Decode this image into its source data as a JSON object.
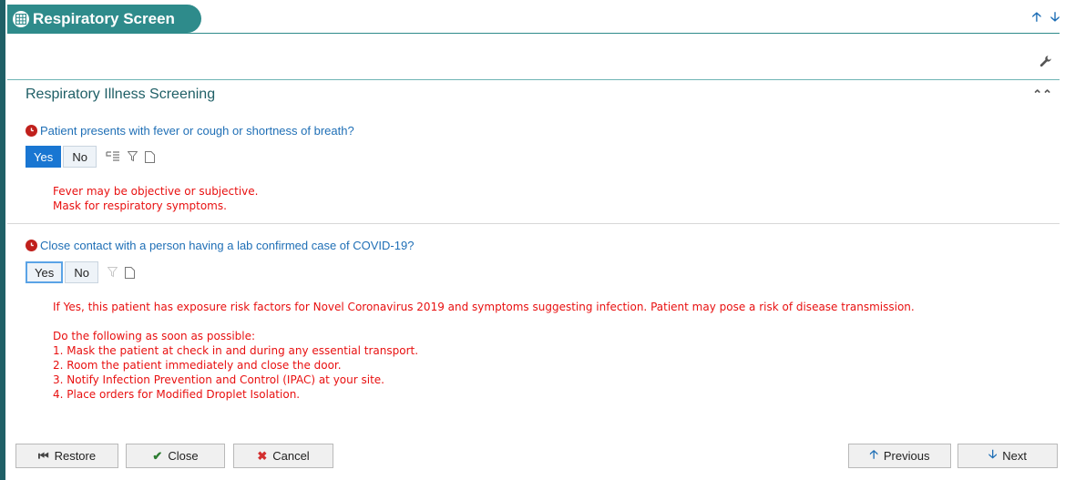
{
  "window": {
    "title": "Respiratory Screen",
    "title_icon": "grid-table-icon",
    "nav_up_icon": "arrow-up-icon",
    "nav_down_icon": "arrow-down-icon",
    "settings_icon": "wrench-icon"
  },
  "section": {
    "title": "Respiratory Illness Screening",
    "collapse_icon": "double-chevron-up-icon"
  },
  "questions": [
    {
      "text": "Patient presents with fever or cough or shortness of breath?",
      "required_icon": "required-clock-icon",
      "options": [
        "Yes",
        "No"
      ],
      "selected": "Yes",
      "notes": [
        "Fever may be objective or subjective.",
        "Mask for respiratory symptoms."
      ]
    },
    {
      "text": "Close contact with a person having a lab confirmed case of COVID-19?",
      "required_icon": "required-clock-icon",
      "options": [
        "Yes",
        "No"
      ],
      "focused": "Yes",
      "notes": [
        "If Yes, this patient has exposure risk factors for Novel Coronavirus 2019 and symptoms suggesting infection. Patient may pose a risk of disease transmission.",
        "Do the following as soon as possible:",
        "1. Mask the patient at check in and during any essential transport.",
        "2. Room the patient immediately and close the door.",
        "3. Notify Infection Prevention and Control (IPAC) at your site.",
        "4. Place orders for Modified Droplet Isolation."
      ]
    }
  ],
  "footer": {
    "restore": "Restore",
    "close": "Close",
    "cancel": "Cancel",
    "previous": "Previous",
    "next": "Next"
  },
  "colors": {
    "accent": "#2e8b8b",
    "selected": "#1976d2",
    "question_text": "#1f6fb6",
    "note_text": "#e81010",
    "required": "#c0201c"
  }
}
